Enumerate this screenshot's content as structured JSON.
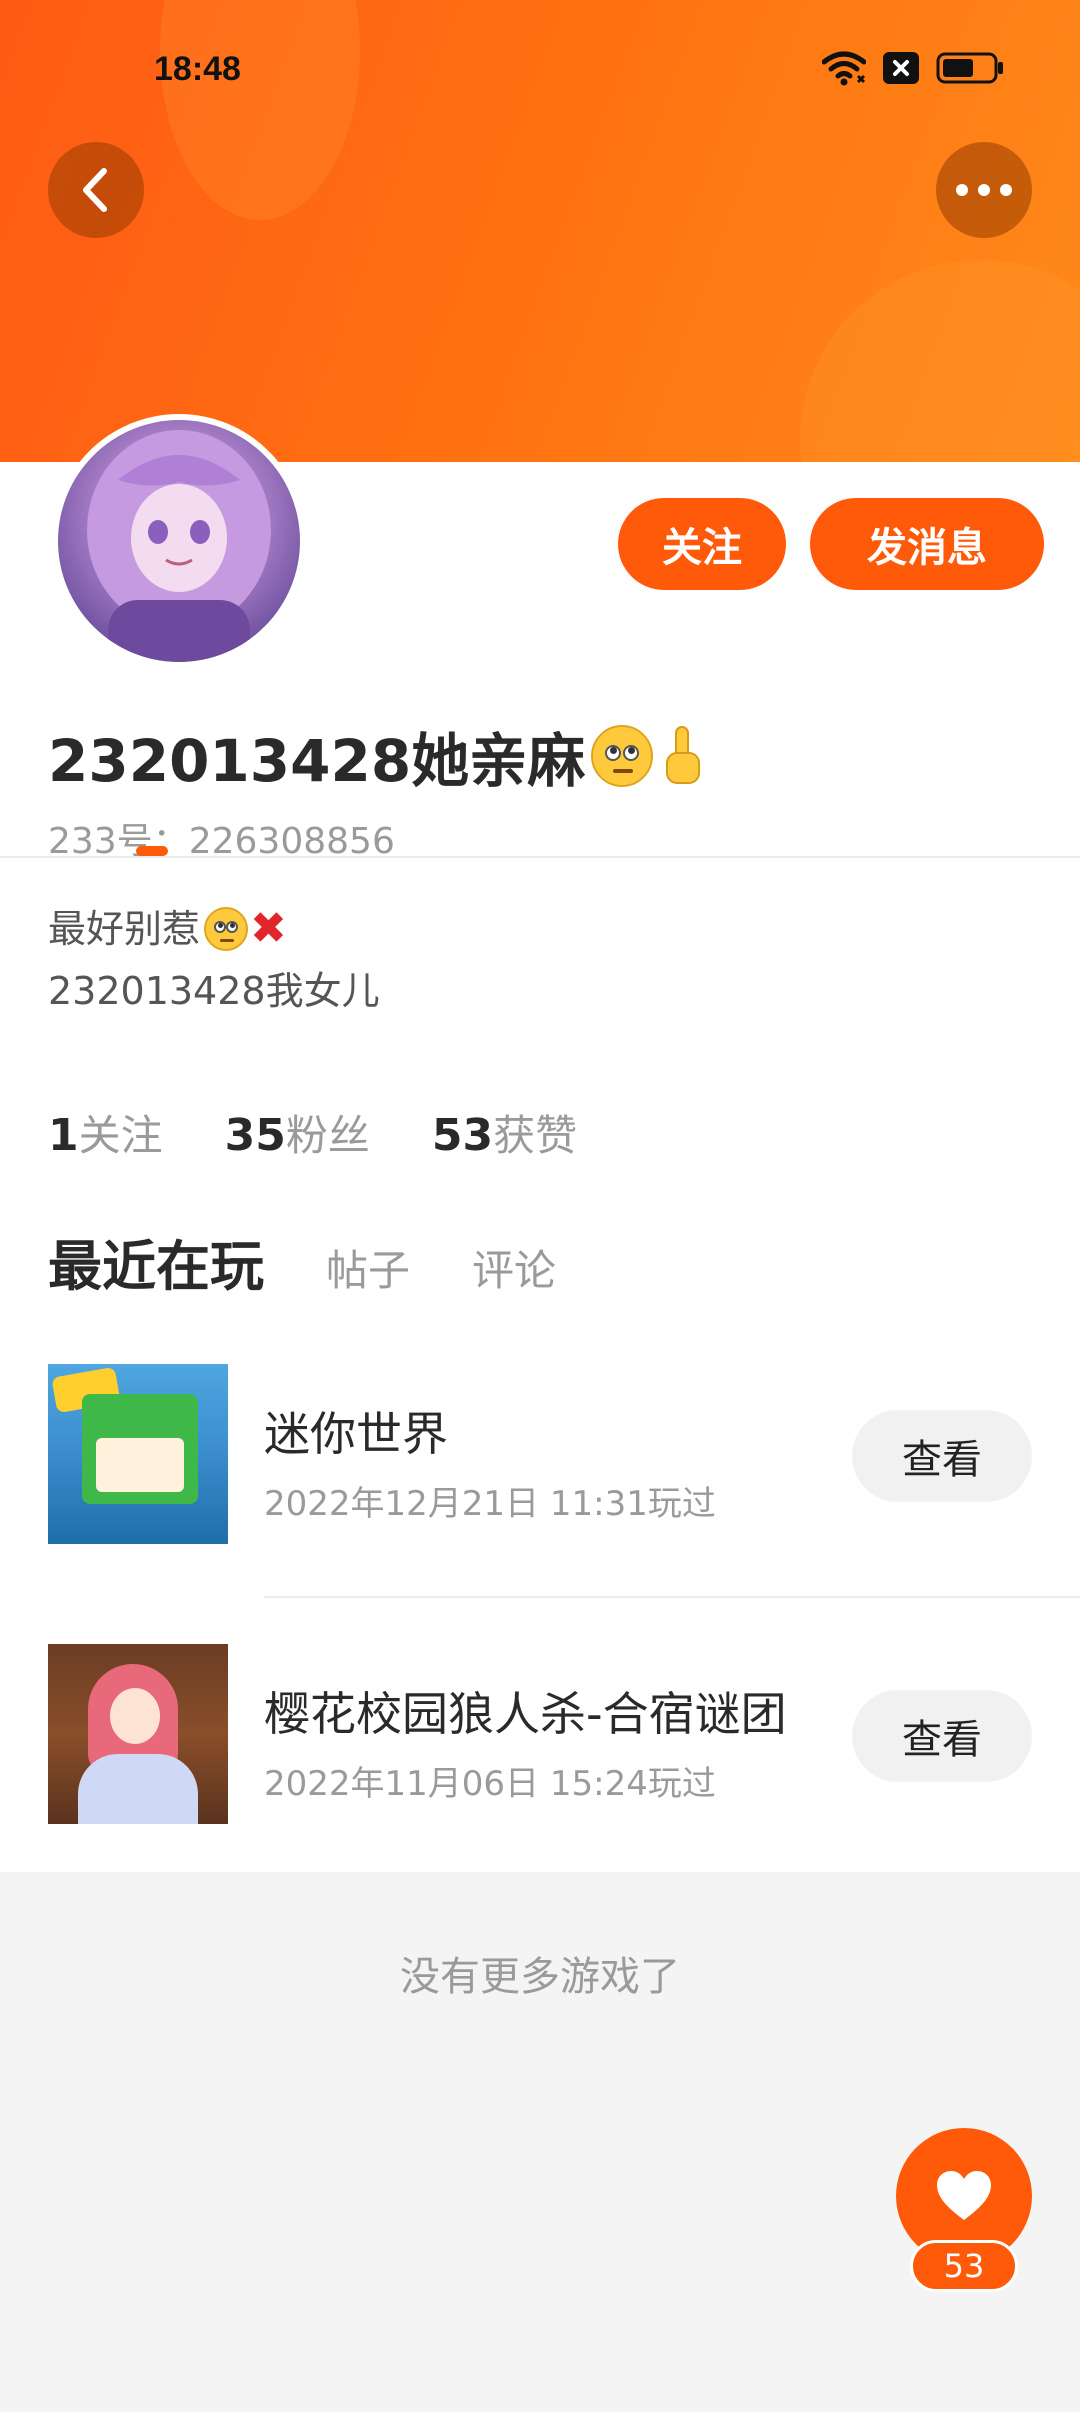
{
  "status_bar": {
    "time": "18:48",
    "icons": [
      "wifi-icon",
      "sim-blocked-icon",
      "battery-icon"
    ]
  },
  "nav": {
    "back_icon": "chevron-left-icon",
    "more_icon": "more-horizontal-icon"
  },
  "profile": {
    "follow_label": "关注",
    "message_label": "发消息",
    "name": "232013428她亲麻",
    "uid": "233号：226308856",
    "bio_line1": "最好别惹",
    "bio_line2": "232013428我女儿",
    "cross": "❌",
    "finger": "☝"
  },
  "stats": [
    {
      "num": "1",
      "label": "关注"
    },
    {
      "num": "35",
      "label": "粉丝"
    },
    {
      "num": "53",
      "label": "获赞"
    }
  ],
  "tabs": [
    {
      "label": "最近在玩",
      "active": true
    },
    {
      "label": "帖子",
      "active": false
    },
    {
      "label": "评论",
      "active": false
    }
  ],
  "games": [
    {
      "title": "迷你世界",
      "time": "2022年12月21日 11:31玩过",
      "button": "查看"
    },
    {
      "title": "樱花校园狼人杀-合宿谜团",
      "time": "2022年11月06日 15:24玩过",
      "button": "查看"
    }
  ],
  "footer": {
    "no_more": "没有更多游戏了"
  },
  "like": {
    "count": "53",
    "icon": "heart-icon"
  },
  "colors": {
    "accent": "#ff5a0a",
    "header_start": "#ff5a14",
    "header_end": "#ff8a1a"
  }
}
